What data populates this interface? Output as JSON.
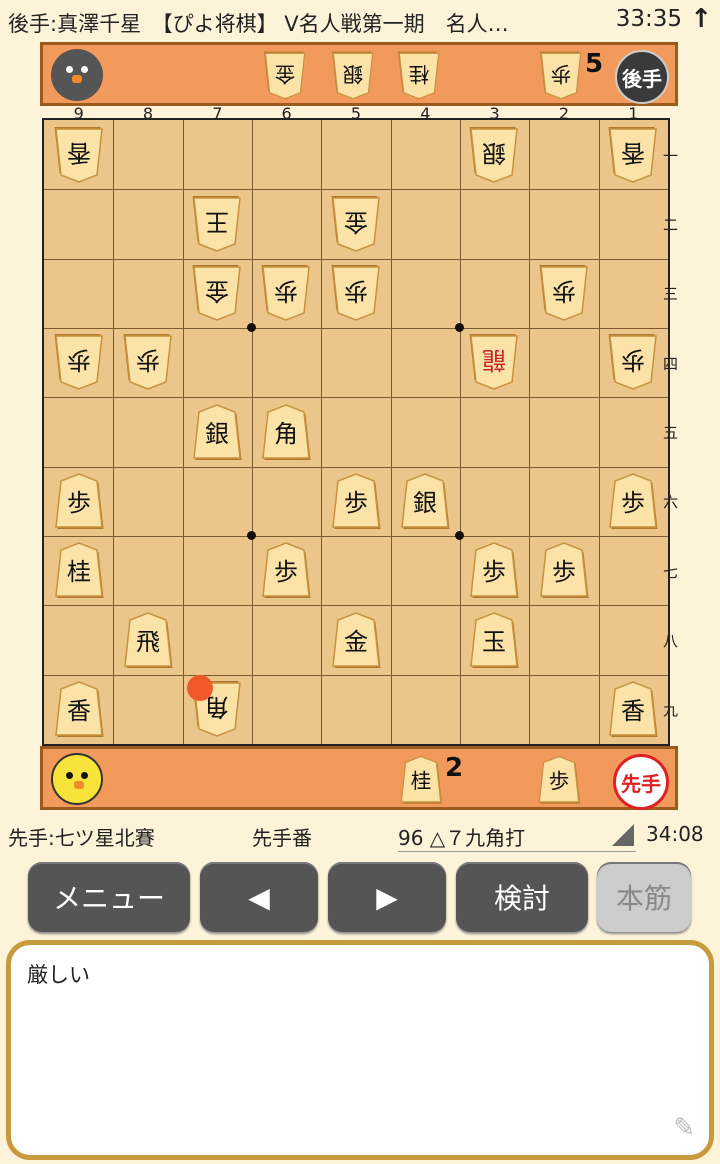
{
  "header": {
    "title": "後手:真澤千星　【ぴよ将棋】 V名人戦第一期　名人…",
    "clock": "33:35",
    "arrow": "↑"
  },
  "gote_hand": {
    "label": "後手",
    "pieces": [
      {
        "name": "金",
        "count": ""
      },
      {
        "name": "銀",
        "count": ""
      },
      {
        "name": "桂",
        "count": ""
      },
      {
        "name": "歩",
        "count": "5"
      }
    ]
  },
  "sente_hand": {
    "label": "先手",
    "pieces": [
      {
        "name": "桂",
        "count": "2"
      },
      {
        "name": "歩",
        "count": ""
      }
    ]
  },
  "board": {
    "file_labels": [
      "9",
      "8",
      "7",
      "6",
      "5",
      "4",
      "3",
      "2",
      "1"
    ],
    "rank_labels": [
      "一",
      "二",
      "三",
      "四",
      "五",
      "六",
      "七",
      "八",
      "九"
    ],
    "pieces": [
      {
        "file": 9,
        "rank": 1,
        "name": "香",
        "side": "gote"
      },
      {
        "file": 3,
        "rank": 1,
        "name": "銀",
        "side": "gote"
      },
      {
        "file": 1,
        "rank": 1,
        "name": "香",
        "side": "gote"
      },
      {
        "file": 7,
        "rank": 2,
        "name": "王",
        "side": "gote"
      },
      {
        "file": 5,
        "rank": 2,
        "name": "金",
        "side": "gote"
      },
      {
        "file": 7,
        "rank": 3,
        "name": "金",
        "side": "gote"
      },
      {
        "file": 6,
        "rank": 3,
        "name": "歩",
        "side": "gote"
      },
      {
        "file": 5,
        "rank": 3,
        "name": "歩",
        "side": "gote"
      },
      {
        "file": 2,
        "rank": 3,
        "name": "歩",
        "side": "gote"
      },
      {
        "file": 9,
        "rank": 4,
        "name": "歩",
        "side": "gote"
      },
      {
        "file": 8,
        "rank": 4,
        "name": "歩",
        "side": "gote"
      },
      {
        "file": 3,
        "rank": 4,
        "name": "龍",
        "side": "gote",
        "promoted": true
      },
      {
        "file": 1,
        "rank": 4,
        "name": "歩",
        "side": "gote"
      },
      {
        "file": 7,
        "rank": 5,
        "name": "銀",
        "side": "sente"
      },
      {
        "file": 6,
        "rank": 5,
        "name": "角",
        "side": "sente"
      },
      {
        "file": 9,
        "rank": 6,
        "name": "歩",
        "side": "sente"
      },
      {
        "file": 5,
        "rank": 6,
        "name": "歩",
        "side": "sente"
      },
      {
        "file": 4,
        "rank": 6,
        "name": "銀",
        "side": "sente"
      },
      {
        "file": 1,
        "rank": 6,
        "name": "歩",
        "side": "sente"
      },
      {
        "file": 9,
        "rank": 7,
        "name": "桂",
        "side": "sente"
      },
      {
        "file": 6,
        "rank": 7,
        "name": "歩",
        "side": "sente"
      },
      {
        "file": 3,
        "rank": 7,
        "name": "歩",
        "side": "sente"
      },
      {
        "file": 2,
        "rank": 7,
        "name": "歩",
        "side": "sente"
      },
      {
        "file": 8,
        "rank": 8,
        "name": "飛",
        "side": "sente"
      },
      {
        "file": 5,
        "rank": 8,
        "name": "金",
        "side": "sente"
      },
      {
        "file": 3,
        "rank": 8,
        "name": "玉",
        "side": "sente"
      },
      {
        "file": 9,
        "rank": 9,
        "name": "香",
        "side": "sente"
      },
      {
        "file": 7,
        "rank": 9,
        "name": "角",
        "side": "gote"
      },
      {
        "file": 1,
        "rank": 9,
        "name": "香",
        "side": "sente"
      }
    ],
    "last_move": {
      "file": 7,
      "rank": 9
    }
  },
  "info": {
    "sente_name": "先手:七ツ星北賽",
    "turn": "先手番",
    "move": "96 △７九角打",
    "time": "34:08"
  },
  "buttons": {
    "menu": "メニュー",
    "prev": "◀",
    "next": "▶",
    "analyze": "検討",
    "mainline": "本筋"
  },
  "comment": {
    "text": "厳しい",
    "pencil_icon": "✎"
  },
  "colors": {
    "board": "#ecc58a",
    "hand": "#f29a5c",
    "piece_face": "#fbe3a8",
    "promoted_text": "#c0262a"
  }
}
